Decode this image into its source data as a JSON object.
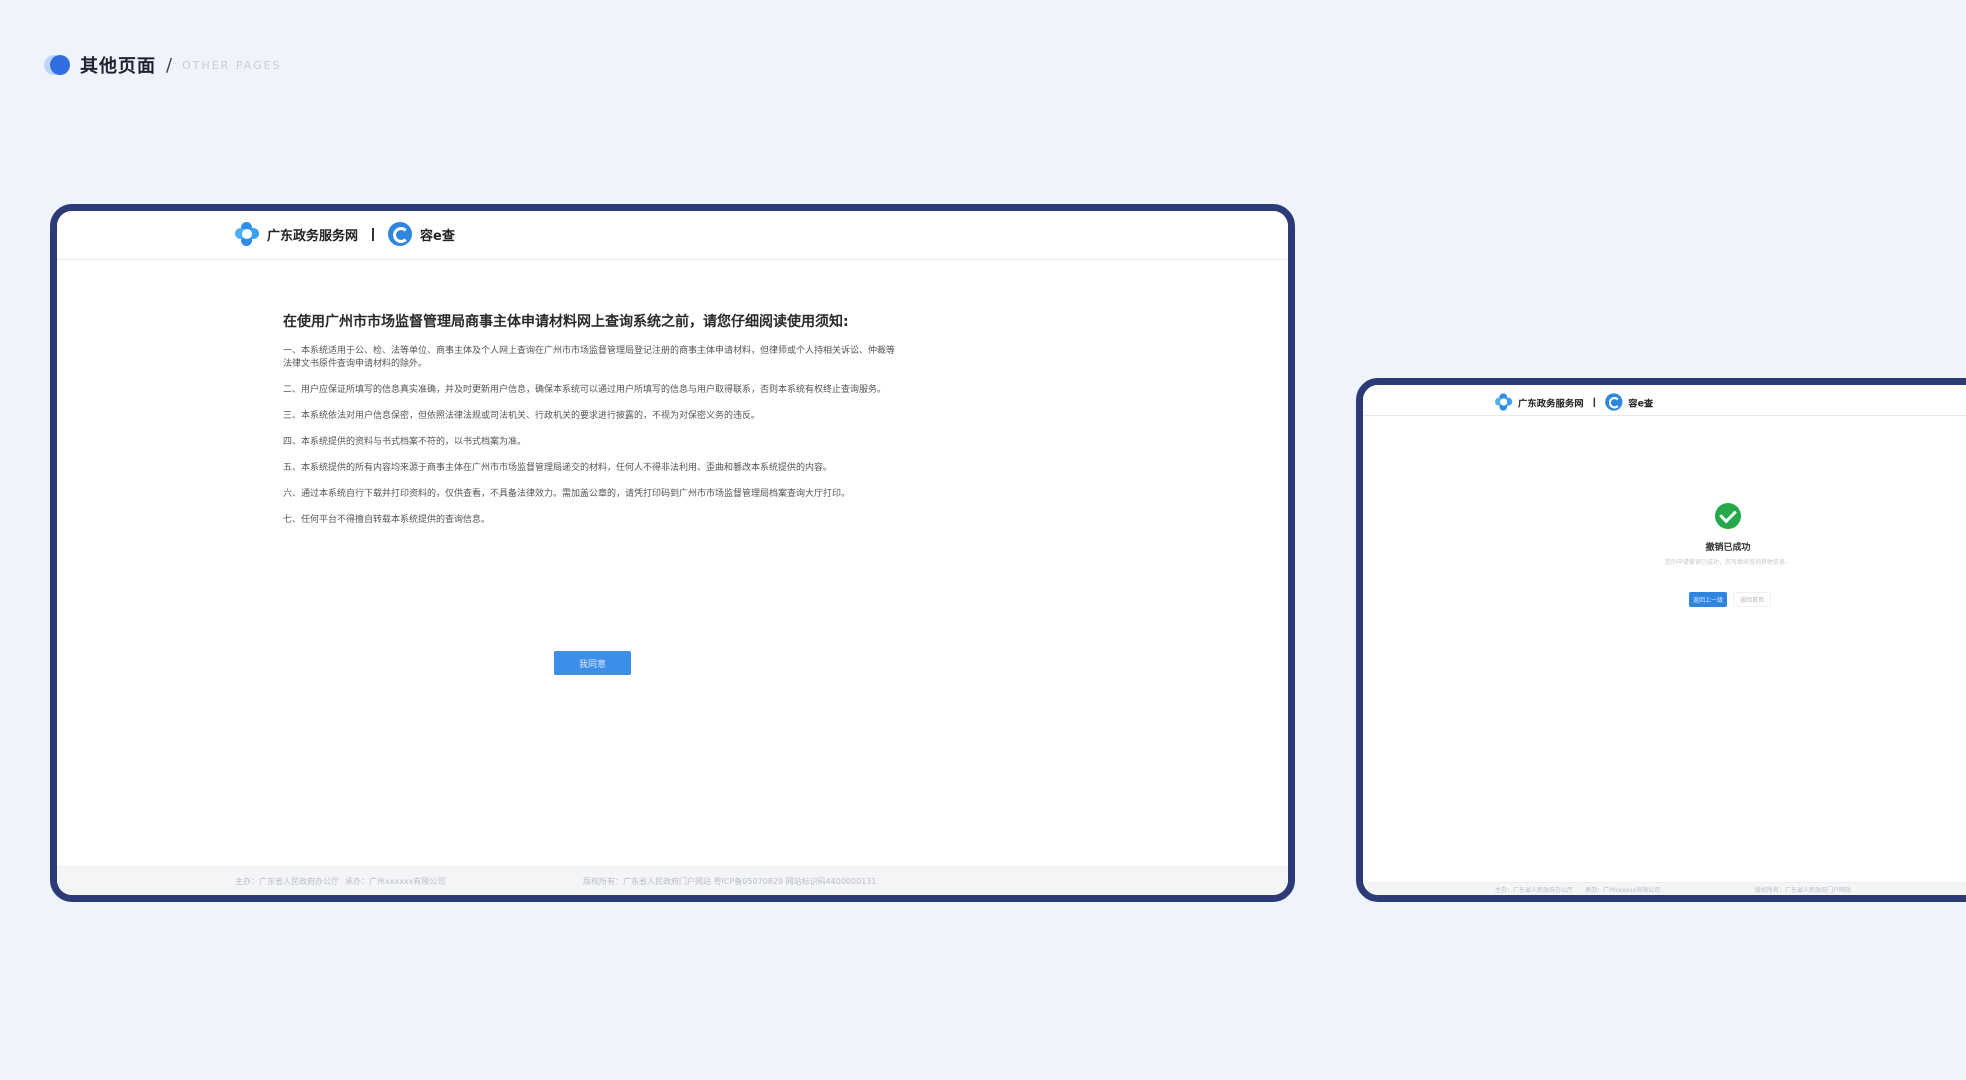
{
  "header": {
    "title": "其他页面",
    "separator": "/",
    "subtitle": "OTHER PAGES"
  },
  "site": {
    "name": "广东政务服务网",
    "app_name": "容e查"
  },
  "notice": {
    "title": "在使用广州市市场监督管理局商事主体申请材料网上查询系统之前，请您仔细阅读使用须知:",
    "items": [
      "一、本系统适用于公、检、法等单位、商事主体及个人网上查询在广州市市场监督管理局登记注册的商事主体申请材料，但律师或个人持相关诉讼、仲裁等法律文书原件查询申请材料的除外。",
      "二、用户应保证所填写的信息真实准确，并及时更新用户信息，确保本系统可以通过用户所填写的信息与用户取得联系，否则本系统有权终止查询服务。",
      "三、本系统依法对用户信息保密，但依照法律法规或司法机关、行政机关的要求进行披露的，不视为对保密义务的违反。",
      "四、本系统提供的资料与书式档案不符的，以书式档案为准。",
      "五、本系统提供的所有内容均来源于商事主体在广州市市场监督管理局递交的材料，任何人不得非法利用、歪曲和篡改本系统提供的内容。",
      "六、通过本系统自行下载并打印资料的，仅供查看，不具备法律效力。需加盖公章的，请凭打印码到广州市市场监督管理局档案查询大厅打印。",
      "七、任何平台不得擅自转载本系统提供的查询信息。"
    ],
    "button": "我同意"
  },
  "footer": {
    "sponsor": "主办：广东省人民政府办公厅",
    "undertaker": "承办：广州xxxxxx有限公司",
    "copyright": "版权所有：广东省人民政府门户网站 粤ICP备05070829 网站标识码4400000131"
  },
  "success": {
    "title": "撤销已成功",
    "subtitle": "您的申请撤销已成功，您可继续查询其他信息。",
    "primary_button": "返回上一级",
    "secondary_button": "返回首页"
  },
  "side_footer": {
    "sponsor": "主办：广东省人民政府办公厅",
    "undertaker": "承办：广州xxxxxx有限公司",
    "copyright": "版权所有：广东省人民政府门户网站"
  },
  "colors": {
    "frame": "#2c3a78",
    "accent": "#2e86de",
    "success": "#26a94a",
    "background": "#eef3fc"
  }
}
